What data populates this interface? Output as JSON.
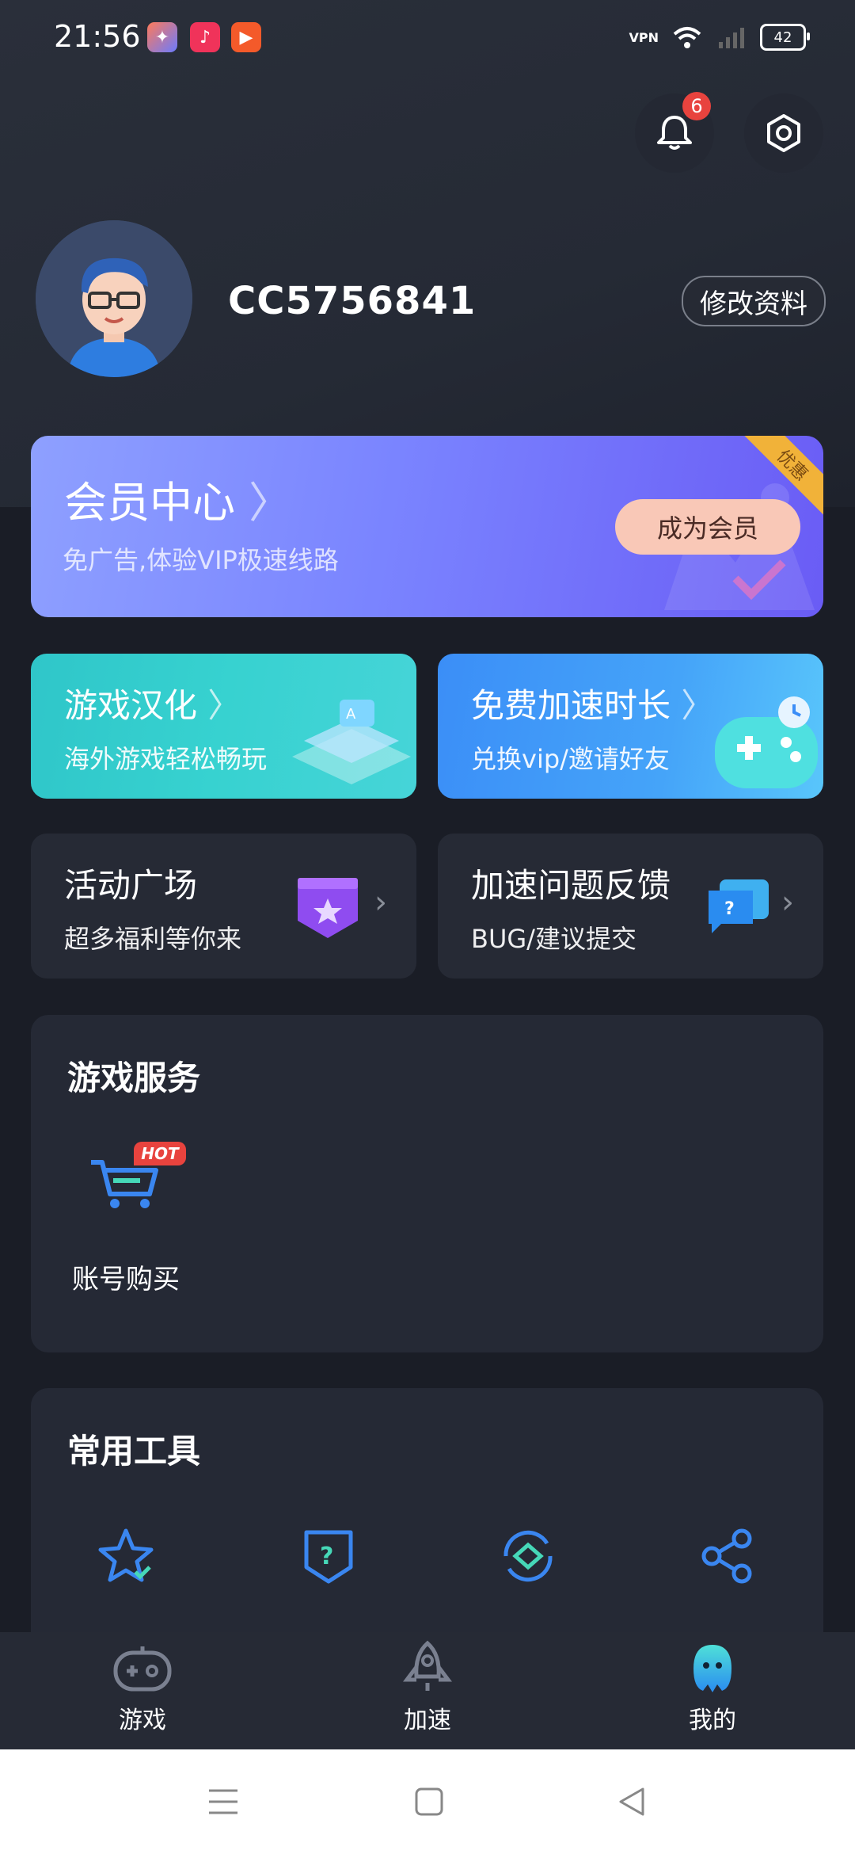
{
  "status_bar": {
    "time": "21:56",
    "vpn_label": "VPN",
    "battery": "42"
  },
  "header": {
    "notification_count": "6",
    "username": "CC5756841",
    "edit_profile_label": "修改资料"
  },
  "vip_card": {
    "title": "会员中心",
    "subtitle": "免广告,体验VIP极速线路",
    "button_label": "成为会员",
    "corner_tag": "优惠"
  },
  "feature_tiles": [
    {
      "title": "游戏汉化",
      "subtitle": "海外游戏轻松畅玩"
    },
    {
      "title": "免费加速时长",
      "subtitle": "兑换vip/邀请好友"
    }
  ],
  "dark_tiles": [
    {
      "title": "活动广场",
      "subtitle": "超多福利等你来"
    },
    {
      "title": "加速问题反馈",
      "subtitle": "BUG/建议提交"
    }
  ],
  "game_services": {
    "title": "游戏服务",
    "items": [
      {
        "label": "账号购买",
        "badge": "HOT"
      }
    ]
  },
  "tools": {
    "title": "常用工具"
  },
  "bottom_nav": {
    "items": [
      {
        "label": "游戏"
      },
      {
        "label": "加速"
      },
      {
        "label": "我的"
      }
    ]
  },
  "colors": {
    "background": "#1a1d26",
    "card": "#252935",
    "vip_gradient_start": "#8ea0ff",
    "vip_gradient_end": "#6a5cf5",
    "accent_blue": "#3a86f0",
    "badge_red": "#e8433e"
  }
}
